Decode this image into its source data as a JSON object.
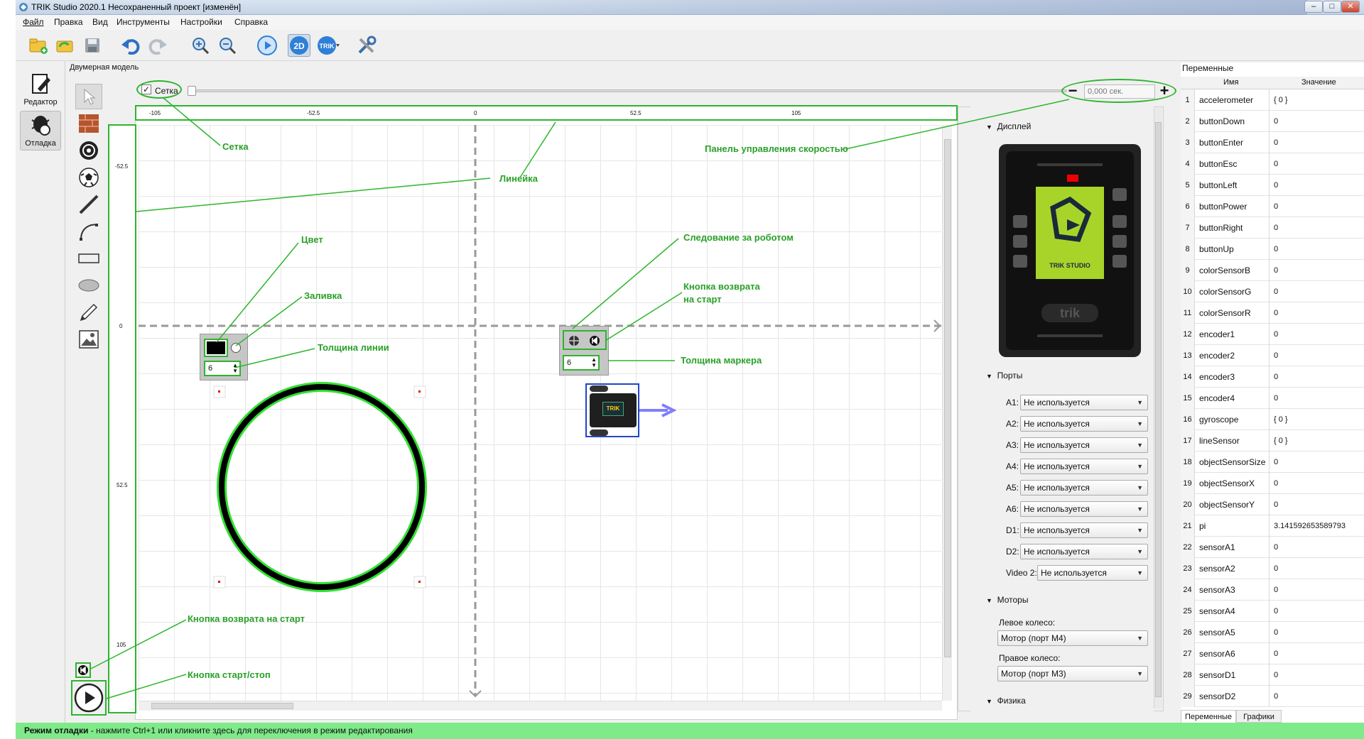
{
  "window": {
    "title": "TRIK Studio 2020.1 Несохраненный проект [изменён]",
    "minimize": "–",
    "maximize": "□",
    "close": "✕"
  },
  "menu": [
    "Файл",
    "Правка",
    "Вид",
    "Инструменты",
    "Настройки",
    "Справка"
  ],
  "toolbar": {
    "icons": [
      "new-project-icon",
      "open-icon",
      "save-icon",
      "undo-icon",
      "redo-icon",
      "zoom-in-icon",
      "zoom-out-icon",
      "run-icon",
      "2d-mode-icon",
      "trik-icon",
      "tools-icon"
    ],
    "mode2d": "2D",
    "trik": "TRIK"
  },
  "sidebar": {
    "editor": "Редактор",
    "debug": "Отладка"
  },
  "palette_title": "Двумерная модель",
  "grid_checkbox": {
    "label": "Сетка",
    "checked": true
  },
  "speed": {
    "value_placeholder": "0,000 сек."
  },
  "ruler": {
    "h_ticks": [
      "-105",
      "-52.5",
      "0",
      "52.5",
      "105"
    ],
    "v_ticks": [
      "-52.5",
      "0",
      "52.5",
      "105"
    ]
  },
  "line_tool": {
    "thickness": "6"
  },
  "marker_tool": {
    "thickness": "6"
  },
  "robot": {
    "label": "TRIK"
  },
  "display": {
    "section": "Дисплей",
    "brand": "TRIK STUDIO",
    "logo": "trik"
  },
  "ports": {
    "section": "Порты",
    "items": [
      {
        "port": "A1:",
        "value": "Не используется"
      },
      {
        "port": "A2:",
        "value": "Не используется"
      },
      {
        "port": "A3:",
        "value": "Не используется"
      },
      {
        "port": "A4:",
        "value": "Не используется"
      },
      {
        "port": "A5:",
        "value": "Не используется"
      },
      {
        "port": "A6:",
        "value": "Не используется"
      },
      {
        "port": "D1:",
        "value": "Не используется"
      },
      {
        "port": "D2:",
        "value": "Не используется"
      },
      {
        "port": "Video 2:",
        "value": "Не используется"
      }
    ]
  },
  "motors": {
    "section": "Моторы",
    "left_label": "Левое колесо:",
    "left_value": "Мотор (порт M4)",
    "right_label": "Правое колесо:",
    "right_value": "Мотор (порт M3)"
  },
  "physics": {
    "section": "Физика"
  },
  "variables": {
    "title": "Переменные",
    "col_name": "Имя",
    "col_value": "Значение",
    "rows": [
      {
        "n": "1",
        "name": "accelerometer",
        "value": "{ 0 }"
      },
      {
        "n": "2",
        "name": "buttonDown",
        "value": "0"
      },
      {
        "n": "3",
        "name": "buttonEnter",
        "value": "0"
      },
      {
        "n": "4",
        "name": "buttonEsc",
        "value": "0"
      },
      {
        "n": "5",
        "name": "buttonLeft",
        "value": "0"
      },
      {
        "n": "6",
        "name": "buttonPower",
        "value": "0"
      },
      {
        "n": "7",
        "name": "buttonRight",
        "value": "0"
      },
      {
        "n": "8",
        "name": "buttonUp",
        "value": "0"
      },
      {
        "n": "9",
        "name": "colorSensorB",
        "value": "0"
      },
      {
        "n": "10",
        "name": "colorSensorG",
        "value": "0"
      },
      {
        "n": "11",
        "name": "colorSensorR",
        "value": "0"
      },
      {
        "n": "12",
        "name": "encoder1",
        "value": "0"
      },
      {
        "n": "13",
        "name": "encoder2",
        "value": "0"
      },
      {
        "n": "14",
        "name": "encoder3",
        "value": "0"
      },
      {
        "n": "15",
        "name": "encoder4",
        "value": "0"
      },
      {
        "n": "16",
        "name": "gyroscope",
        "value": "{ 0 }"
      },
      {
        "n": "17",
        "name": "lineSensor",
        "value": "{ 0 }"
      },
      {
        "n": "18",
        "name": "objectSensorSize",
        "value": "0"
      },
      {
        "n": "19",
        "name": "objectSensorX",
        "value": "0"
      },
      {
        "n": "20",
        "name": "objectSensorY",
        "value": "0"
      },
      {
        "n": "21",
        "name": "pi",
        "value": "3.141592653589793"
      },
      {
        "n": "22",
        "name": "sensorA1",
        "value": "0"
      },
      {
        "n": "23",
        "name": "sensorA2",
        "value": "0"
      },
      {
        "n": "24",
        "name": "sensorA3",
        "value": "0"
      },
      {
        "n": "25",
        "name": "sensorA4",
        "value": "0"
      },
      {
        "n": "26",
        "name": "sensorA5",
        "value": "0"
      },
      {
        "n": "27",
        "name": "sensorA6",
        "value": "0"
      },
      {
        "n": "28",
        "name": "sensorD1",
        "value": "0"
      },
      {
        "n": "29",
        "name": "sensorD2",
        "value": "0"
      }
    ],
    "tabs": [
      "Переменные",
      "Графики"
    ]
  },
  "annotations": {
    "grid": "Сетка",
    "ruler": "Линейка",
    "speed_panel": "Панель управления скоростью",
    "color": "Цвет",
    "fill": "Заливка",
    "line_thickness": "Толщина линии",
    "follow_robot": "Следование за роботом",
    "return_button_1": "Кнопка возврата",
    "return_button_2": "на старт",
    "marker_thickness": "Толщина маркера",
    "return_to_start": "Кнопка возврата на старт",
    "start_stop": "Кнопка старт/стоп"
  },
  "status": {
    "bold": "Режим отладки",
    "text": " - нажмите Ctrl+1 или кликните здесь для переключения в режим редактирования"
  },
  "colors": {
    "annotation": "#28a028",
    "status_bg": "#7fea8a",
    "lime": "#a8d42a"
  }
}
